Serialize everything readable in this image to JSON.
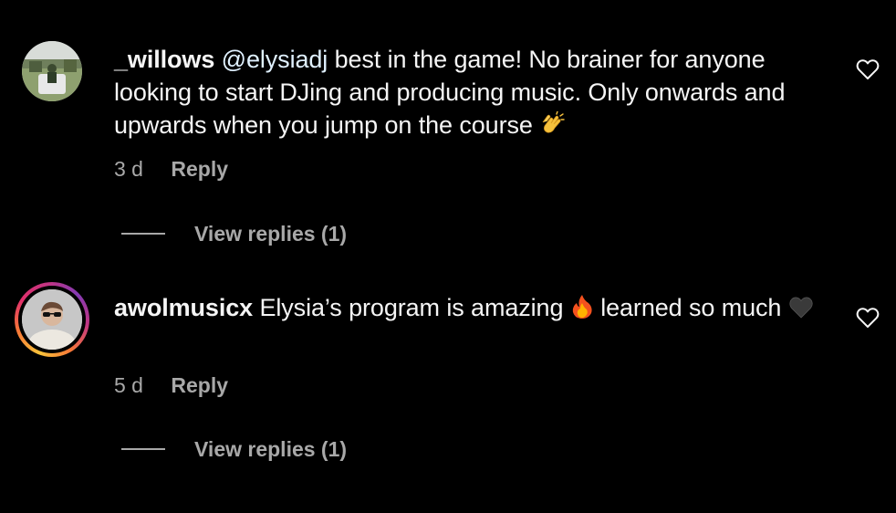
{
  "comments": [
    {
      "username": "_willows",
      "mention": "@elysiadj",
      "text": " best in the game! No brainer for anyone looking to start DJing and producing music. Only onwards and upwards when you jump on the course ",
      "emoji": "clapping-hands",
      "time": "3 d",
      "reply_label": "Reply",
      "view_replies_label": "View replies (1)",
      "has_story_ring": false
    },
    {
      "username": "awolmusicx",
      "text_before": " Elysia’s program is amazing ",
      "emoji_1": "fire",
      "text_after": " learned so much ",
      "emoji_2": "black-heart",
      "time": "5 d",
      "reply_label": "Reply",
      "view_replies_label": "View replies (1)",
      "has_story_ring": true
    }
  ],
  "colors": {
    "background": "#000000",
    "text": "#f5f5f5",
    "secondary": "#a8a8a8",
    "mention": "#e0f1ff"
  },
  "icons": {
    "like": "heart-outline-icon"
  }
}
